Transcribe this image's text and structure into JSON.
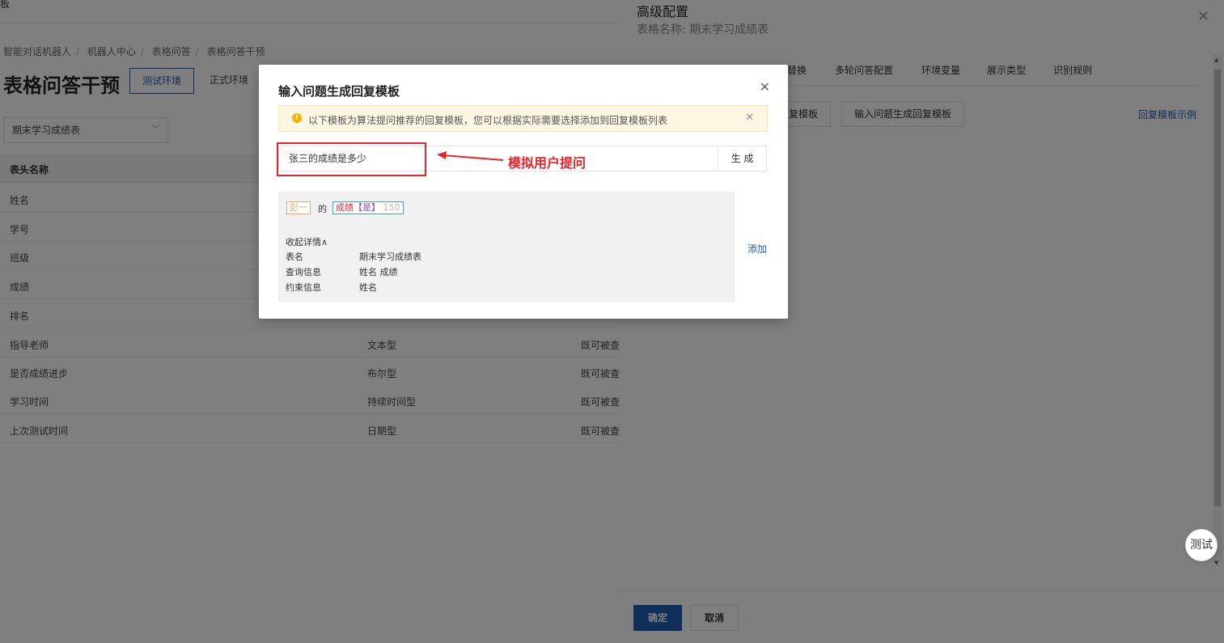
{
  "background": {
    "top_fragment": "板",
    "breadcrumb": [
      "智能对话机器人",
      "机器人中心",
      "表格问答",
      "表格问答干预"
    ],
    "title": "表格问答干预",
    "env_tabs": [
      "测试环境",
      "正式环境"
    ],
    "table_select": "期末学习成绩表",
    "table_header": "表头名称",
    "rows": [
      {
        "name": "姓名",
        "type": "",
        "desc": ""
      },
      {
        "name": "学号",
        "type": "",
        "desc": ""
      },
      {
        "name": "班级",
        "type": "",
        "desc": ""
      },
      {
        "name": "成绩",
        "type": "",
        "desc": ""
      },
      {
        "name": "排名",
        "type": "",
        "desc": ""
      },
      {
        "name": "指导老师",
        "type": "文本型",
        "desc": "既可被查"
      },
      {
        "name": "是否成绩进步",
        "type": "布尔型",
        "desc": "既可被查"
      },
      {
        "name": "学习时间",
        "type": "持续时间型",
        "desc": "既可被查"
      },
      {
        "name": "上次测试时间",
        "type": "日期型",
        "desc": "既可被查"
      }
    ]
  },
  "drawer": {
    "title": "高级配置",
    "subtitle": "表格名称: 期末学习成绩表",
    "tabs": [
      "替换",
      "多轮问答配置",
      "环境变量",
      "展示类型",
      "识别规则"
    ],
    "buttons": [
      "回复模板",
      "输入问题生成回复模板"
    ],
    "link": "回复模板示例",
    "ok": "确定",
    "cancel": "取消"
  },
  "test_fab": "测试",
  "modal": {
    "title": "输入问题生成回复模板",
    "alert": "以下模板为算法提问推荐的回复模板，您可以根据实际需要选择添加到回复模板列表",
    "input_value": "张三的成绩是多少",
    "generate": "生 成",
    "annotation": "模拟用户提问",
    "tokens": {
      "name": "彭一",
      "de": "的",
      "score_label": "成绩",
      "score_flag": "【是】",
      "score_value": "150"
    },
    "collapse": "收起详情∧",
    "details": [
      {
        "k": "表名",
        "v": "期末学习成绩表"
      },
      {
        "k": "查询信息",
        "v": "姓名 成绩"
      },
      {
        "k": "约束信息",
        "v": "姓名"
      }
    ],
    "add": "添加"
  },
  "colors": {
    "primary": "#1f5fb4",
    "annotation_red": "#e8242c",
    "alert_bg": "#fdf6e3"
  }
}
